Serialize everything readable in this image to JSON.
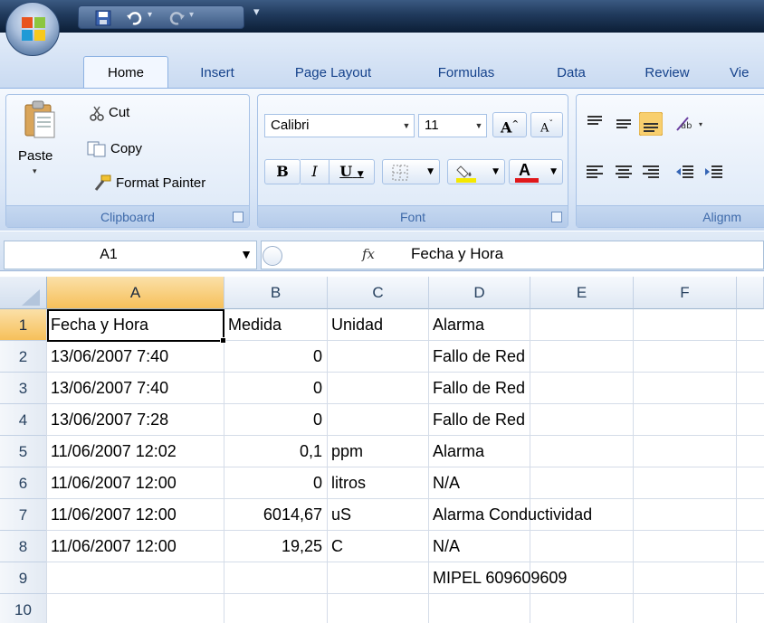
{
  "titlebar": {
    "office_button_icon": "office-logo-icon",
    "qat_icons": [
      "save-icon",
      "undo-icon",
      "redo-icon",
      "customize-qat-icon"
    ]
  },
  "tabs": [
    "Home",
    "Insert",
    "Page Layout",
    "Formulas",
    "Data",
    "Review",
    "Vie"
  ],
  "ribbon": {
    "clipboard": {
      "paste_label": "Paste",
      "cut_label": "Cut",
      "copy_label": "Copy",
      "format_painter_label": "Format Painter",
      "group_label": "Clipboard"
    },
    "font": {
      "font_name": "Calibri",
      "font_size": "11",
      "bold": "B",
      "italic": "I",
      "underline": "U",
      "grow": "A",
      "shrink": "A",
      "font_color": "A",
      "group_label": "Font"
    },
    "alignment": {
      "group_label": "Alignm"
    }
  },
  "formula_bar": {
    "name_box": "A1",
    "fx": "fx",
    "value": "Fecha y Hora"
  },
  "columns": [
    "A",
    "B",
    "C",
    "D",
    "E",
    "F"
  ],
  "rows": [
    "1",
    "2",
    "3",
    "4",
    "5",
    "6",
    "7",
    "8",
    "9",
    "10"
  ],
  "cells": [
    [
      "Fecha y Hora",
      "Medida",
      "Unidad",
      "Alarma"
    ],
    [
      "13/06/2007 7:40",
      "0",
      "",
      "Fallo de Red"
    ],
    [
      "13/06/2007 7:40",
      "0",
      "",
      "Fallo de Red"
    ],
    [
      "13/06/2007 7:28",
      "0",
      "",
      "Fallo de Red"
    ],
    [
      "11/06/2007 12:02",
      "0,1",
      "ppm",
      "Alarma"
    ],
    [
      "11/06/2007 12:00",
      "0",
      "litros",
      "N/A"
    ],
    [
      "11/06/2007 12:00",
      "6014,67",
      "uS",
      "Alarma Conductividad"
    ],
    [
      "11/06/2007 12:00",
      "19,25",
      "C",
      "N/A"
    ],
    [
      "",
      "",
      "",
      "MIPEL 609609609"
    ],
    [
      "",
      "",
      "",
      ""
    ]
  ],
  "colors": {
    "selection_header": "#f6c05a",
    "ribbon_text": "#15428b",
    "font_color_bar": "#e0181b",
    "highlight_bar": "#f4e800"
  }
}
